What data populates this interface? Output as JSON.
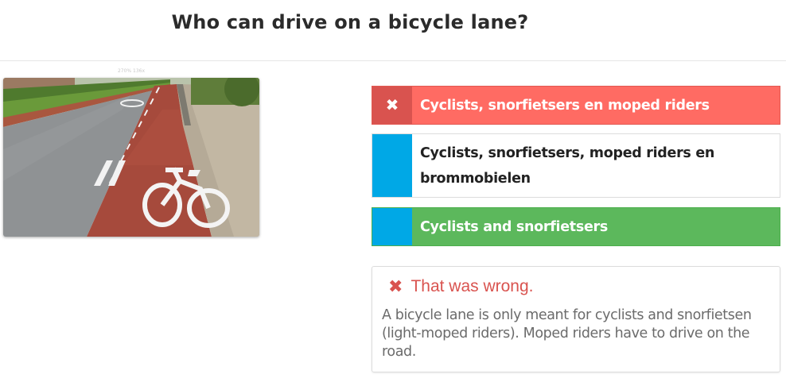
{
  "question": {
    "title": "Who can drive on a bicycle lane?"
  },
  "image": {
    "caption": "270% 136x"
  },
  "answers": [
    {
      "label": "Cyclists, snorfietsers en moped riders",
      "status": "selected-wrong",
      "marker_icon": "close-icon",
      "marker_glyph": "✖"
    },
    {
      "label": "Cyclists, snorfietsers, moped riders en brommobielen",
      "status": "neutral"
    },
    {
      "label": "Cyclists and snorfietsers",
      "status": "correct"
    }
  ],
  "feedback": {
    "icon": "close-icon",
    "icon_glyph": "✖",
    "heading": "That was wrong.",
    "body": "A bicycle lane is only meant for cyclists and snorfietsen (light-moped riders). Moped riders have to drive on the road."
  },
  "colors": {
    "wrong": "#ff6b63",
    "wrong_dark": "#d9534f",
    "correct": "#5cb85c",
    "marker_blue": "#00a8e6"
  }
}
